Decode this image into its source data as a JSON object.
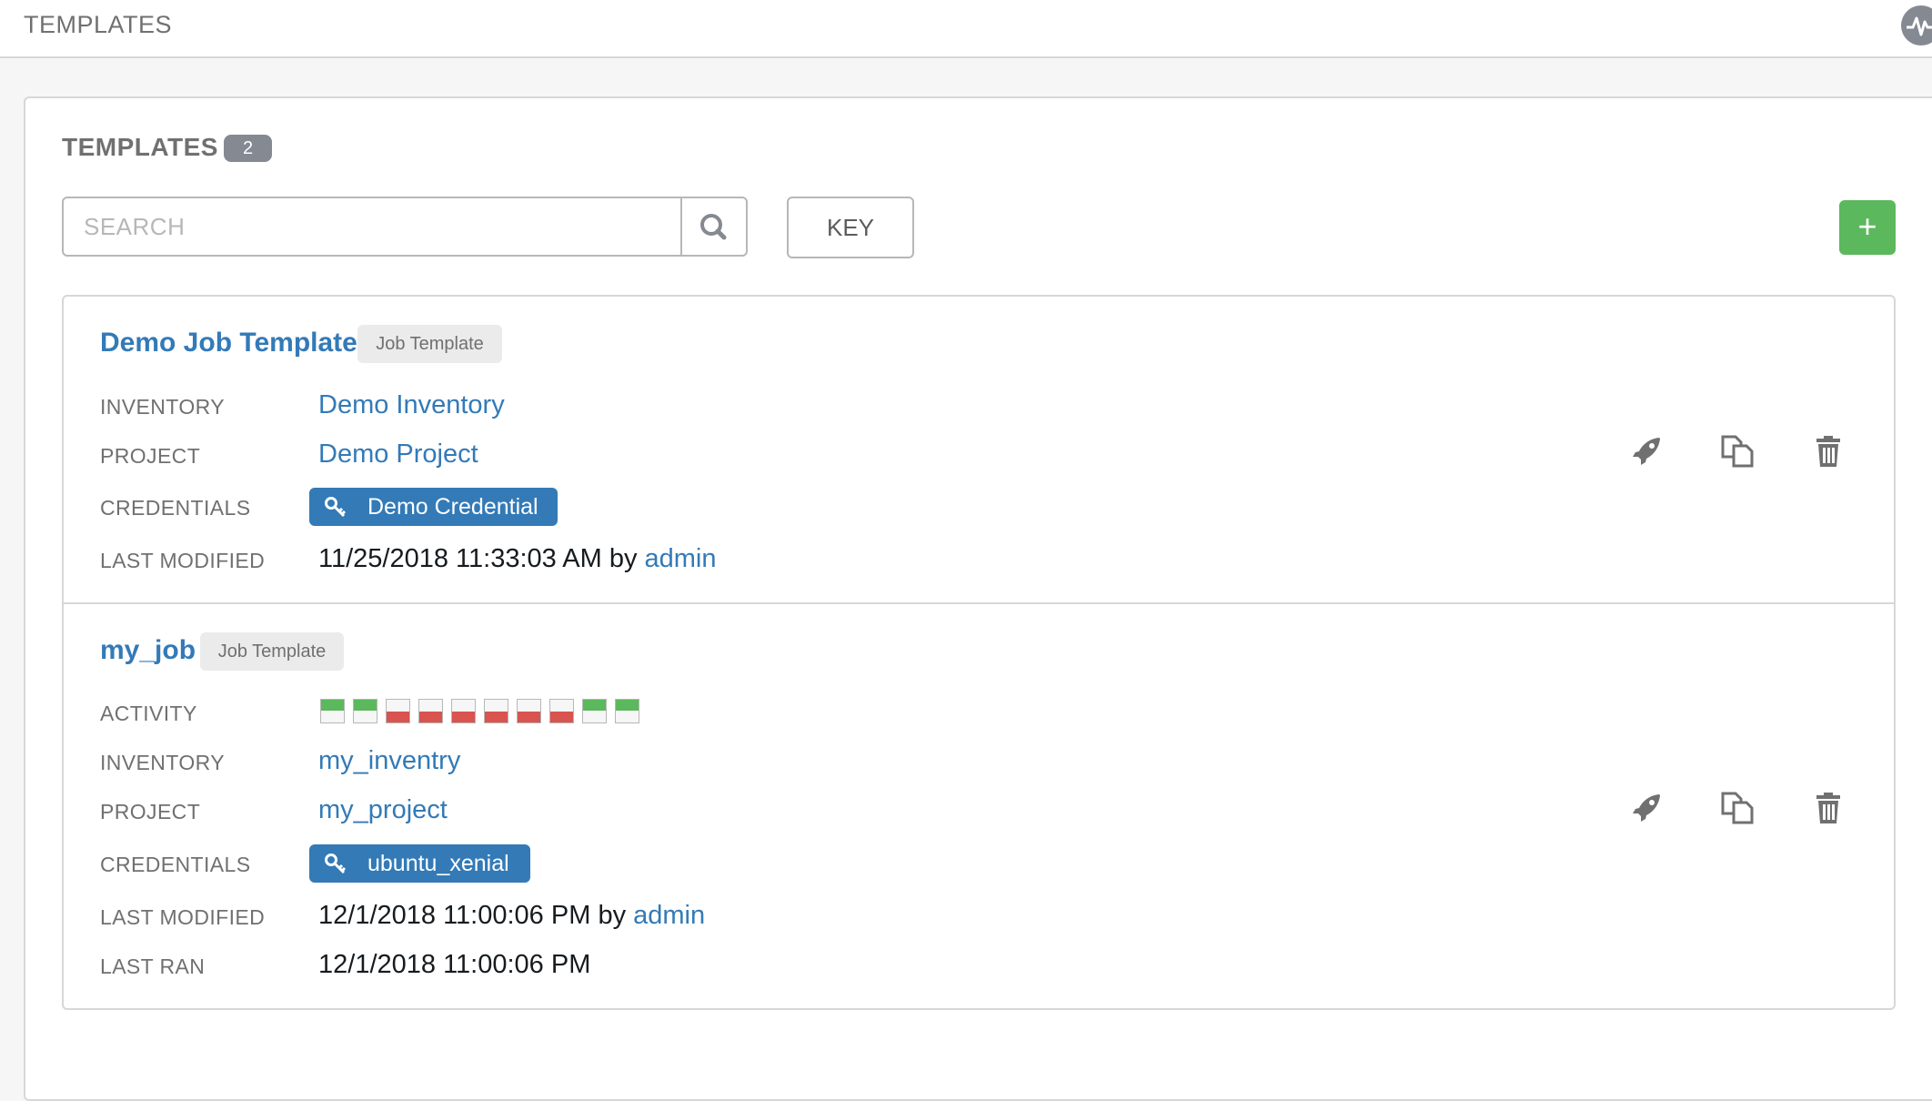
{
  "header": {
    "title": "TEMPLATES"
  },
  "panel": {
    "title": "TEMPLATES",
    "count": "2"
  },
  "search": {
    "placeholder": "SEARCH"
  },
  "toolbar": {
    "key_label": "KEY",
    "add_label": "+"
  },
  "labels": {
    "activity": "ACTIVITY",
    "inventory": "INVENTORY",
    "project": "PROJECT",
    "credentials": "CREDENTIALS",
    "last_modified": "LAST MODIFIED",
    "last_ran": "LAST RAN"
  },
  "templates": [
    {
      "name": "Demo Job Template",
      "type": "Job Template",
      "inventory": "Demo Inventory",
      "project": "Demo Project",
      "credential": "Demo Credential",
      "last_modified": "11/25/2018 11:33:03 AM",
      "by_label": "by",
      "modified_by": "admin"
    },
    {
      "name": "my_job",
      "type": "Job Template",
      "activity": [
        "success",
        "success",
        "failed",
        "failed",
        "failed",
        "failed",
        "failed",
        "failed",
        "success",
        "success"
      ],
      "inventory": "my_inventry",
      "project": "my_project",
      "credential": "ubuntu_xenial",
      "last_modified": "12/1/2018 11:00:06 PM",
      "by_label": "by",
      "modified_by": "admin",
      "last_ran": "12/1/2018 11:00:06 PM"
    }
  ],
  "icons": {
    "activity_stream": "pulse-icon",
    "search": "search-icon",
    "credential": "key-icon",
    "launch": "rocket-icon",
    "copy": "copy-icon",
    "delete": "trash-icon"
  },
  "colors": {
    "link": "#337ab7",
    "success": "#5cb85c",
    "failed": "#d9534f",
    "badge": "#848992"
  }
}
